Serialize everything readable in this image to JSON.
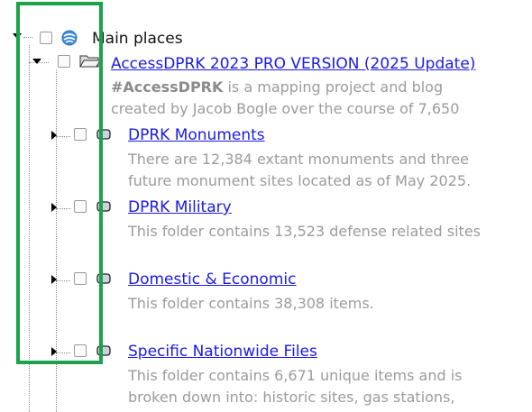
{
  "tree": {
    "root": {
      "label": "Main places",
      "checked": false,
      "expanded": true,
      "icon": "earth-globe-icon"
    },
    "project": {
      "title": "AccessDPRK 2023 PRO VERSION (2025 Update)",
      "desc_bold": "#AccessDPRK",
      "desc_line1_rest": " is a mapping project and blog",
      "desc_line2": "created by Jacob Bogle over the course of 7,650",
      "checked": false,
      "expanded": true,
      "icon": "open-folder-icon"
    },
    "folders": [
      {
        "title": "DPRK Monuments",
        "desc_lines": [
          "There are 12,384 extant monuments and three",
          "future monument sites located as of May 2025."
        ],
        "checked": false,
        "expanded": false
      },
      {
        "title": "DPRK Military",
        "desc_lines": [
          "This folder contains 13,523 defense related sites"
        ],
        "checked": false,
        "expanded": false
      },
      {
        "title": "Domestic & Economic",
        "desc_lines": [
          "This folder contains 38,308 items."
        ],
        "checked": false,
        "expanded": false
      },
      {
        "title": "Specific Nationwide Files",
        "desc_lines": [
          "This folder contains 6,671 unique items and is",
          "broken down into: historic sites, gas stations,"
        ],
        "checked": false,
        "expanded": false
      }
    ]
  },
  "colors": {
    "link": "#1a1ae6",
    "description": "#9b9b9b",
    "highlight": "#1aa34a"
  }
}
